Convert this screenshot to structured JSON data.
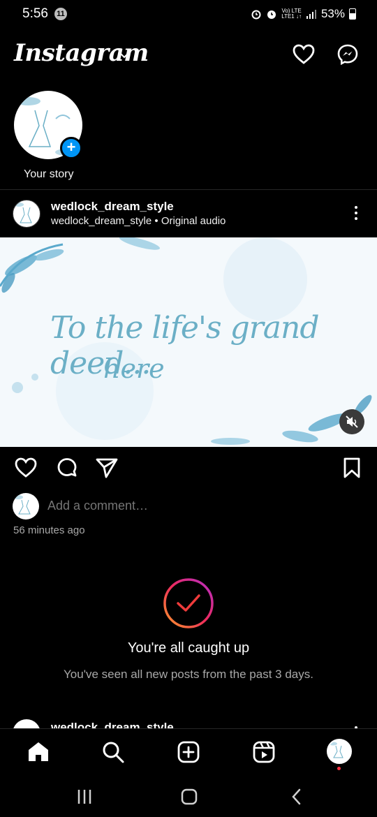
{
  "status": {
    "time": "5:56",
    "notification_count": "11",
    "network_top": "Vo) LTE",
    "network_bottom": "LTE1 ↓↑",
    "battery": "53%"
  },
  "header": {
    "brand": "Instagram",
    "icons": [
      "heart-icon",
      "messenger-icon"
    ]
  },
  "stories": {
    "own_label": "Your story",
    "avatar_text": "wedlock dream style"
  },
  "post": {
    "username": "wedlock_dream_style",
    "subtitle": "wedlock_dream_style • Original audio",
    "media_line1": "To the life's grand deed...",
    "media_line2": "here",
    "comment_placeholder": "Add a comment…",
    "time_ago": "56 minutes ago"
  },
  "caught_up": {
    "title": "You're all caught up",
    "subtitle": "You've seen all new posts from the past 3 days."
  },
  "next_post": {
    "username": "wedlock_dream_style"
  },
  "colors": {
    "background": "#000000",
    "accent_blue": "#0095f6",
    "muted_text": "#a8a8a8",
    "media_script": "#6bafc6",
    "notification_dot": "#ff3040"
  }
}
